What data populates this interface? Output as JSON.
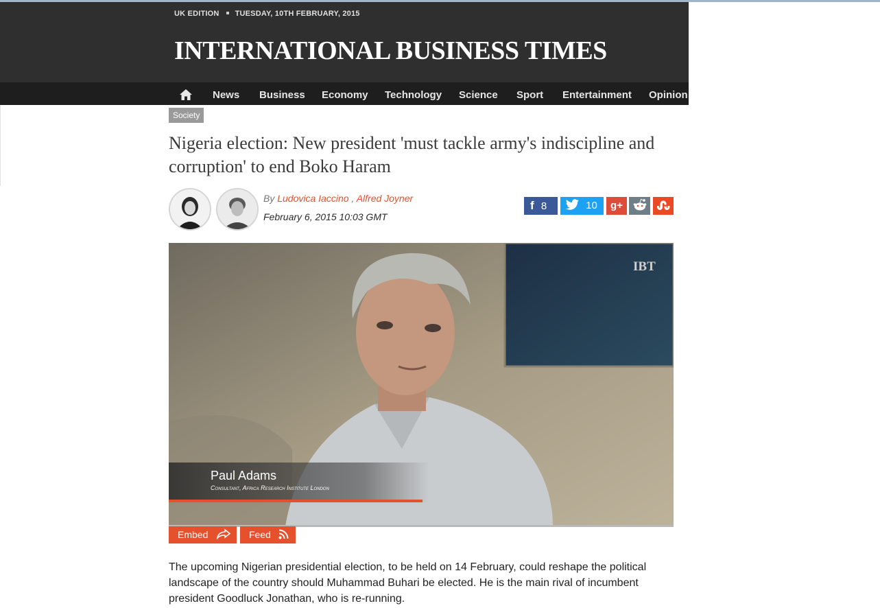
{
  "header": {
    "edition": "UK EDITION",
    "date": "TUESDAY, 10TH FEBRUARY, 2015",
    "logo": "INTERNATIONAL BUSINESS TIMES"
  },
  "nav": {
    "home_icon": "home-icon",
    "items": [
      "News",
      "Business",
      "Economy",
      "Technology",
      "Science",
      "Sport",
      "Entertainment",
      "Opinion"
    ]
  },
  "article": {
    "tag": "Society",
    "headline": "Nigeria election: New president 'must tackle army's indiscipline and corruption' to end Boko Haram",
    "by_prefix": "By",
    "authors": [
      "Ludovica Iaccino",
      "Alfred Joyner"
    ],
    "author_separator": ",",
    "date": "February 6, 2015 10:03 GMT",
    "paragraph": "The upcoming Nigerian presidential election, to be held on 14 February, could reshape the political landscape of the country should Muhammad Buhari be elected. He is the main rival of incumbent president Goodluck Jonathan, who is re-running."
  },
  "share": {
    "facebook": {
      "icon": "facebook-icon",
      "count": "8",
      "color": "#3b5998"
    },
    "twitter": {
      "icon": "twitter-icon",
      "count": "10",
      "color": "#1da1f2"
    },
    "google": {
      "icon": "google-plus-icon",
      "label": "g+",
      "color": "#dd4b39"
    },
    "reddit": {
      "icon": "reddit-icon",
      "color": "#6e7f87"
    },
    "stumbleupon": {
      "icon": "stumbleupon-icon",
      "color": "#eb4924"
    }
  },
  "video": {
    "watermark": "IBT",
    "lower_third_name": "Paul Adams",
    "lower_third_title": "Consultant, Africa Research Institute London"
  },
  "video_actions": {
    "embed": "Embed",
    "embed_icon": "share-arrow-icon",
    "feed": "Feed",
    "feed_icon": "rss-icon"
  },
  "colors": {
    "accent": "#e5502d",
    "header_bg": "#2f2f2f",
    "nav_bg": "#1e1e1e"
  }
}
